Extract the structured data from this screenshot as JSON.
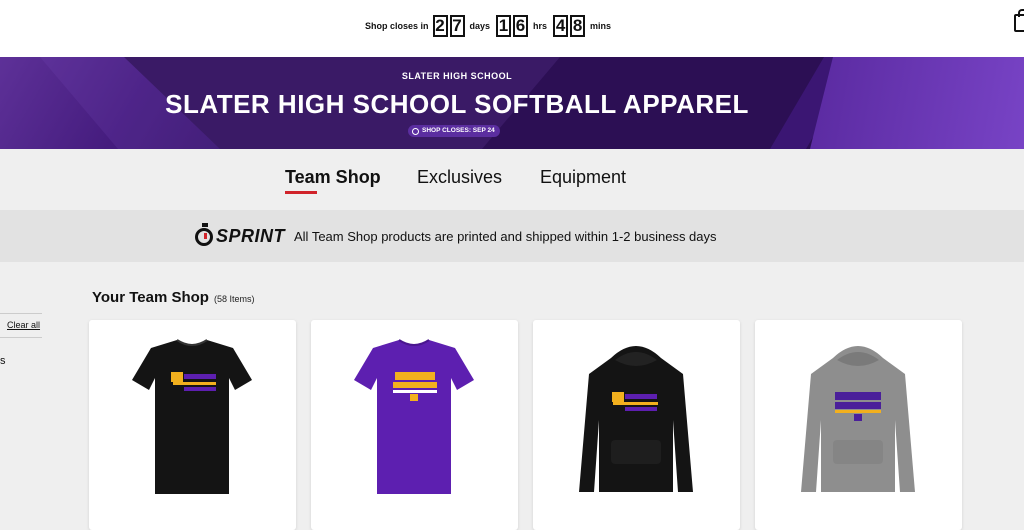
{
  "countdown": {
    "prefix": "Shop closes in",
    "days_digits": [
      "2",
      "7"
    ],
    "days_unit": "days",
    "hours_digits": [
      "1",
      "6"
    ],
    "hours_unit": "hrs",
    "mins_digits": [
      "4",
      "8"
    ],
    "mins_unit": "mins"
  },
  "banner": {
    "school": "SLATER HIGH SCHOOL",
    "title": "SLATER HIGH SCHOOL SOFTBALL APPAREL",
    "closes": "SHOP CLOSES: SEP 24"
  },
  "tabs": [
    {
      "label": "Team Shop",
      "active": true
    },
    {
      "label": "Exclusives",
      "active": false
    },
    {
      "label": "Equipment",
      "active": false
    }
  ],
  "sprint": {
    "logo": "SPRINT",
    "message": "All Team Shop products are printed and shipped within 1-2 business days"
  },
  "filters": {
    "clear_all": "Clear all",
    "fragment": "s"
  },
  "shop": {
    "title": "Your Team Shop",
    "count": "(58 Items)"
  },
  "products": [
    {
      "kind": "tee",
      "color": "#141414",
      "print": "SLATER SOFTBALL",
      "print_color": "#f2b01e"
    },
    {
      "kind": "tee",
      "color": "#5d1fb0",
      "print": "SLATER SOFTBALL S",
      "print_color": "#f2b01e"
    },
    {
      "kind": "hoodie",
      "color": "#141414",
      "print": "SLATER SOFTBALL",
      "print_color": "#f2b01e"
    },
    {
      "kind": "hoodie",
      "color": "#8e8e8e",
      "print": "SLATER SOFTBALL S",
      "print_color": "#4a1f9a"
    }
  ],
  "colors": {
    "accent_red": "#d0232a",
    "banner_purple": "#2c0f54"
  },
  "icons": [
    "shopping-bag-icon",
    "clock-icon",
    "stopwatch-icon"
  ]
}
